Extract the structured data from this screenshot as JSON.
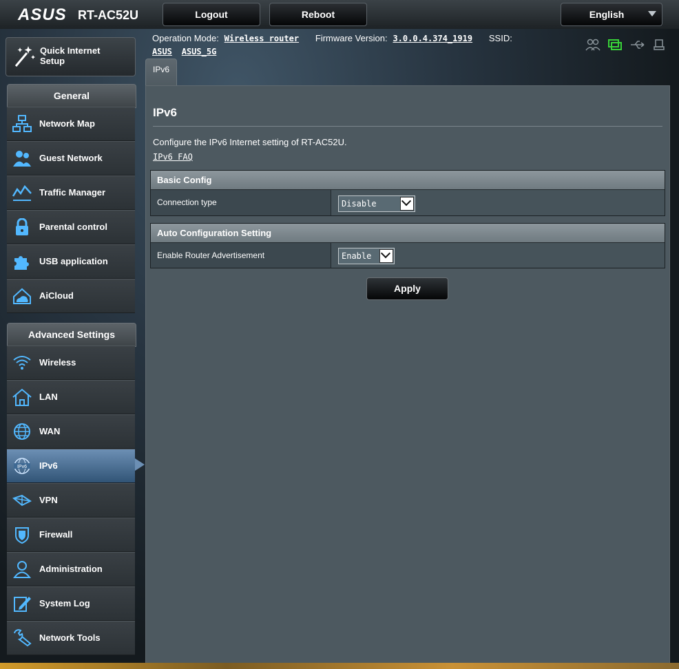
{
  "header": {
    "logo": "ASUS",
    "model": "RT-AC52U",
    "logout_label": "Logout",
    "reboot_label": "Reboot",
    "language_label": "English"
  },
  "info": {
    "op_mode_label": "Operation Mode:",
    "op_mode_value": "Wireless router",
    "fw_label": "Firmware Version:",
    "fw_value": "3.0.0.4.374_1919",
    "ssid_label": "SSID:",
    "ssid_1": "ASUS",
    "ssid_2": "ASUS_5G"
  },
  "sidebar": {
    "qis_label_1": "Quick Internet",
    "qis_label_2": "Setup",
    "general_header": "General",
    "general_items": [
      {
        "label": "Network Map",
        "icon": "network-map-icon"
      },
      {
        "label": "Guest Network",
        "icon": "guest-network-icon"
      },
      {
        "label": "Traffic Manager",
        "icon": "traffic-manager-icon"
      },
      {
        "label": "Parental control",
        "icon": "parental-lock-icon"
      },
      {
        "label": "USB application",
        "icon": "usb-puzzle-icon"
      },
      {
        "label": "AiCloud",
        "icon": "aicloud-icon"
      }
    ],
    "advanced_header": "Advanced Settings",
    "advanced_items": [
      {
        "label": "Wireless",
        "icon": "wifi-icon"
      },
      {
        "label": "LAN",
        "icon": "home-icon"
      },
      {
        "label": "WAN",
        "icon": "globe-icon"
      },
      {
        "label": "IPv6",
        "icon": "ipv6-globe-icon"
      },
      {
        "label": "VPN",
        "icon": "vpn-icon"
      },
      {
        "label": "Firewall",
        "icon": "shield-icon"
      },
      {
        "label": "Administration",
        "icon": "admin-user-icon"
      },
      {
        "label": "System Log",
        "icon": "log-edit-icon"
      },
      {
        "label": "Network Tools",
        "icon": "wrench-icon"
      }
    ]
  },
  "tab": {
    "label": "IPv6"
  },
  "main": {
    "title": "IPv6",
    "description": "Configure the IPv6 Internet setting of RT-AC52U.",
    "faq_link": "IPv6 FAQ",
    "basic_config": {
      "header": "Basic Config",
      "connection_type_label": "Connection type",
      "connection_type_value": "Disable"
    },
    "auto_config": {
      "header": "Auto Configuration Setting",
      "router_adv_label": "Enable Router Advertisement",
      "router_adv_value": "Enable"
    },
    "apply_label": "Apply"
  }
}
